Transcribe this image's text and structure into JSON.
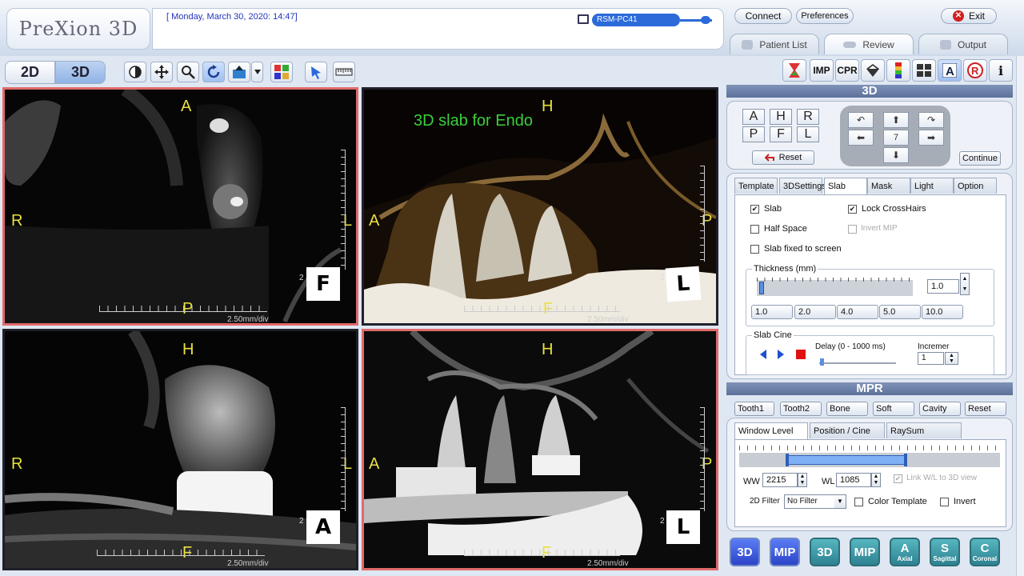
{
  "header": {
    "logo_text": "PreXion 3D",
    "datetime": "[ Monday, March 30, 2020: 14:47]",
    "pc_name": "RSM-PC41",
    "connect_label": "Connect",
    "preferences_label": "Preferences",
    "exit_label": "Exit",
    "exit_icon": "✕",
    "tabs": [
      {
        "label": "Patient List"
      },
      {
        "label": "Review"
      },
      {
        "label": "Output"
      }
    ]
  },
  "toolbar": {
    "view_2d": "2D",
    "view_3d": "3D",
    "tools": [
      "contrast-icon",
      "pan-icon",
      "zoom-icon",
      "rotate-icon",
      "reslice-icon",
      "dropdown-icon",
      "layout-icon",
      "pointer-icon",
      "ruler-icon"
    ]
  },
  "viewports": [
    {
      "top": "A",
      "bottom": "P",
      "left": "R",
      "right": "L",
      "cube": "F",
      "small": "2",
      "scale": "2.50mm/div"
    },
    {
      "top": "H",
      "bottom": "F",
      "left": "A",
      "right": "P",
      "cube": "L",
      "small": "2",
      "scale": "2.50mm/div",
      "title": "3D slab for Endo"
    },
    {
      "top": "H",
      "bottom": "F",
      "left": "R",
      "right": "L",
      "cube": "A",
      "small": "2",
      "scale": "2.50mm/div"
    },
    {
      "top": "H",
      "bottom": "F",
      "left": "A",
      "right": "P",
      "cube": "L",
      "small": "2",
      "scale": "2.50mm/div"
    }
  ],
  "right_toolbar": [
    "IMP",
    "CPR",
    "i"
  ],
  "panel3d": {
    "title": "3D",
    "orient_buttons": [
      "A",
      "H",
      "R",
      "P",
      "F",
      "L"
    ],
    "reset_label": "Reset",
    "step_value": "7",
    "continue_label": "Continue",
    "tabs": [
      "Template",
      "3DSettings",
      "Slab",
      "Mask",
      "Light",
      "Option"
    ],
    "options": {
      "slab": "Slab",
      "slab_checked": true,
      "lock_crosshairs": "Lock CrossHairs",
      "lock_checked": true,
      "half_space": "Half Space",
      "invert_mip": "Invert MIP",
      "slab_fixed": "Slab fixed to screen"
    },
    "thickness_label": "Thickness (mm)",
    "thickness_value": "1.0",
    "thickness_presets": [
      "1.0",
      "2.0",
      "4.0",
      "5.0",
      "10.0"
    ],
    "cine_label": "Slab Cine",
    "delay_label": "Delay (0 - 1000 ms)",
    "increment_label": "Incremer",
    "increment_value": "1"
  },
  "mpr": {
    "title": "MPR",
    "presets": [
      "Tooth1",
      "Tooth2",
      "Bone",
      "Soft",
      "Cavity",
      "Reset"
    ],
    "tabs": [
      "Window Level",
      "Position / Cine",
      "RaySum"
    ],
    "ww_label": "WW",
    "ww_value": "2215",
    "wl_label": "WL",
    "wl_value": "1085",
    "link_label": "Link W/L to 3D view",
    "filter_label": "2D Filter",
    "filter_value": "No Filter",
    "color_template": "Color Template",
    "invert": "Invert"
  },
  "bottom_buttons": [
    {
      "label": "3D",
      "sub": ""
    },
    {
      "label": "MIP",
      "sub": ""
    },
    {
      "label": "3D",
      "sub": ""
    },
    {
      "label": "MIP",
      "sub": ""
    },
    {
      "label": "A",
      "sub": "Axial"
    },
    {
      "label": "S",
      "sub": "Sagittal"
    },
    {
      "label": "C",
      "sub": "Coronal"
    }
  ],
  "colors": {
    "accent": "#2b6ad8",
    "selected_border": "#e06a6a",
    "overlay_text": "#e9e040",
    "title_green": "#3ccf3c"
  }
}
